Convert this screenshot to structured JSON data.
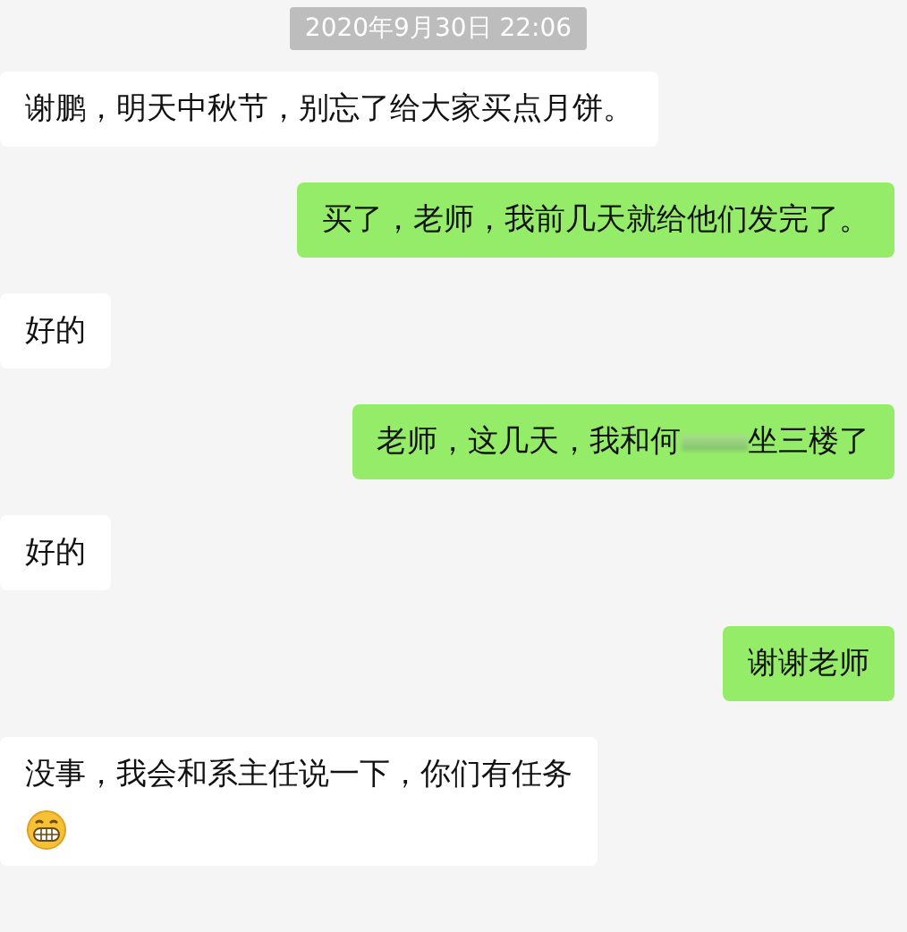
{
  "timestamp": "2020年9月30日 22:06",
  "messages": [
    {
      "kind": "incoming",
      "text": "谢鹏，明天中秋节，别忘了给大家买点月饼。"
    },
    {
      "kind": "outgoing",
      "text": "买了，老师，我前几天就给他们发完了。"
    },
    {
      "kind": "incoming",
      "text": "好的"
    },
    {
      "kind": "outgoing",
      "text": "老师，这几天，我和何",
      "redacted": true,
      "text_after": "坐三楼了"
    },
    {
      "kind": "incoming",
      "text": "好的"
    },
    {
      "kind": "outgoing",
      "text": "谢谢老师"
    },
    {
      "kind": "incoming",
      "text": "没事，我会和系主任说一下，你们有任务",
      "emojis": [
        {
          "kind": "grin"
        }
      ]
    }
  ]
}
